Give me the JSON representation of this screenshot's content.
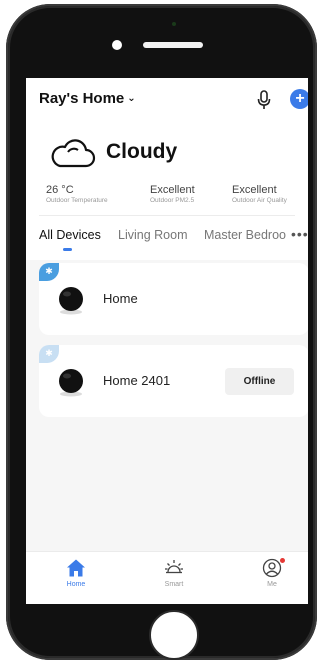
{
  "header": {
    "home_name": "Ray's Home",
    "chevron": "⌄",
    "mic_icon": "microphone-icon",
    "add_icon": "+"
  },
  "weather": {
    "icon": "cloud-icon",
    "condition": "Cloudy",
    "metrics": [
      {
        "value": "26 °C",
        "label": "Outdoor Temperature"
      },
      {
        "value": "Excellent",
        "label": "Outdoor PM2.5"
      },
      {
        "value": "Excellent",
        "label": "Outdoor Air Quality"
      }
    ]
  },
  "tabs": {
    "items": [
      "All Devices",
      "Living Room",
      "Master Bedroom"
    ],
    "more": "•••",
    "active_index": 0
  },
  "devices": [
    {
      "name": "Home",
      "status": "",
      "bluetooth_badge": "✱"
    },
    {
      "name": "Home 2401",
      "status": "Offline",
      "bluetooth_badge": "✱"
    }
  ],
  "bottom_nav": [
    {
      "label": "Home",
      "icon": "home-icon",
      "active": true
    },
    {
      "label": "Smart",
      "icon": "sun-icon",
      "active": false
    },
    {
      "label": "Me",
      "icon": "user-icon",
      "active": false
    }
  ],
  "colors": {
    "accent": "#3b7be8",
    "bluetooth": "#4a9ee0",
    "notification": "#e53935"
  }
}
